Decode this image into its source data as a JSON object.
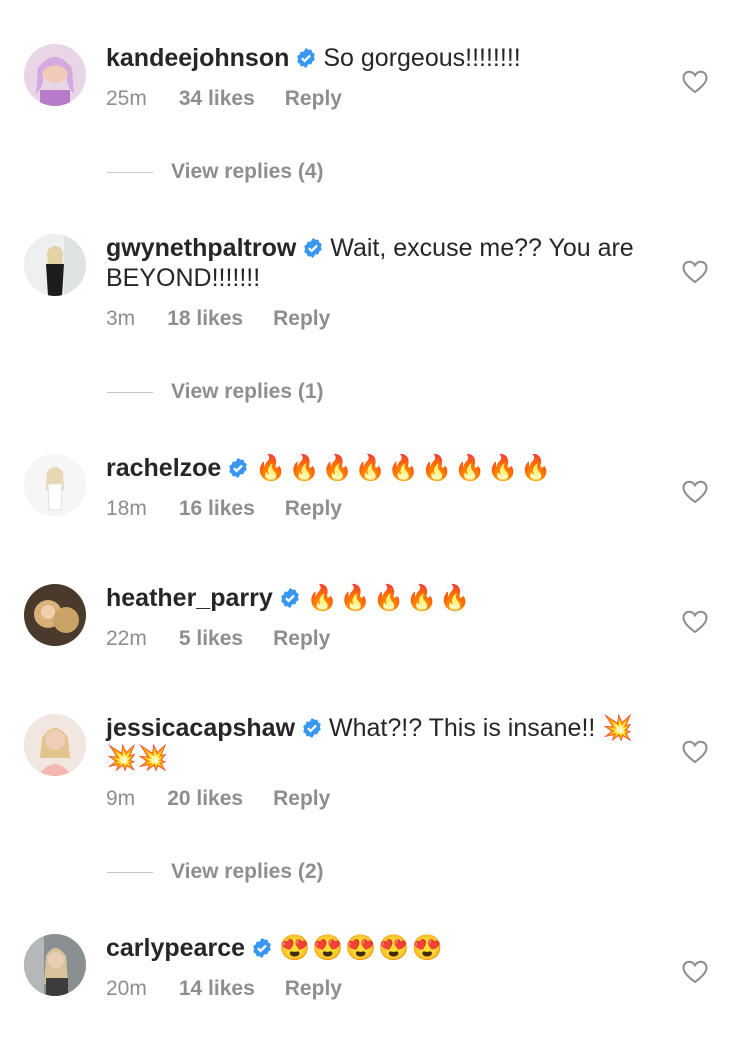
{
  "verified_color": "#3897f0",
  "comments": [
    {
      "user": "kandeejohnson",
      "text": "So gorgeous!!!!!!!!",
      "time": "25m",
      "likes": "34 likes",
      "reply": "Reply",
      "replies": "View replies (4)"
    },
    {
      "user": "gwynethpaltrow",
      "text": "Wait, excuse me?? You are BEYOND!!!!!!!",
      "time": "3m",
      "likes": "18 likes",
      "reply": "Reply",
      "replies": "View replies (1)"
    },
    {
      "user": "rachelzoe",
      "text": "🔥🔥🔥🔥🔥🔥🔥🔥🔥",
      "time": "18m",
      "likes": "16 likes",
      "reply": "Reply"
    },
    {
      "user": "heather_parry",
      "text": "🔥🔥🔥🔥🔥",
      "time": "22m",
      "likes": "5 likes",
      "reply": "Reply"
    },
    {
      "user": "jessicacapshaw",
      "text": "What?!? This is insane!! 💥💥💥",
      "time": "9m",
      "likes": "20 likes",
      "reply": "Reply",
      "replies": "View replies (2)"
    },
    {
      "user": "carlypearce",
      "text": "😍😍😍😍😍",
      "time": "20m",
      "likes": "14 likes",
      "reply": "Reply"
    }
  ]
}
